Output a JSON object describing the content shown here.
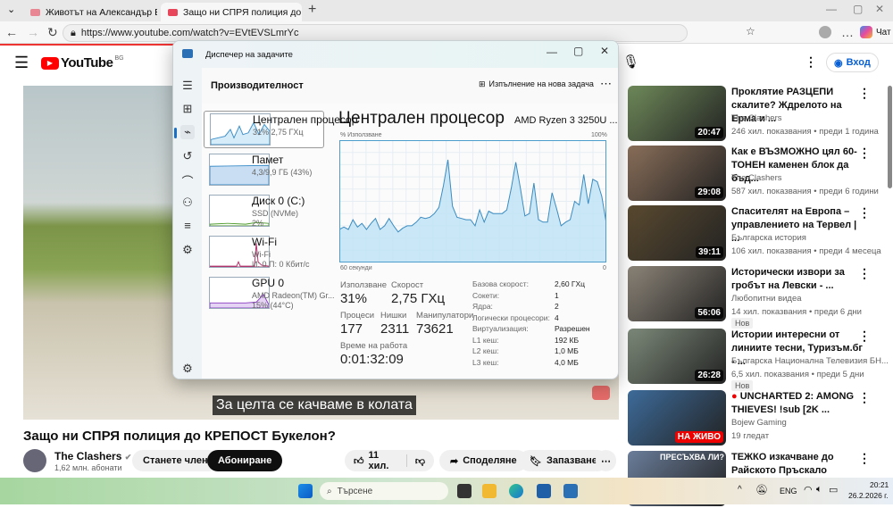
{
  "browser": {
    "tabs": [
      {
        "label": "Животът на Александър Батенбе"
      },
      {
        "label": "Защо ни СПРЯ полиция до КРЕП"
      }
    ],
    "url": "https://www.youtube.com/watch?v=EVtEVSLmrYc",
    "chat_label": "Чат"
  },
  "youtube": {
    "logo": "YouTube",
    "region": "BG",
    "signin": "Вход",
    "subtitle": "За целта се качваме в колата",
    "video_title": "Защо ни СПРЯ полиция до КРЕПОСТ Букелон?",
    "channel": "The Clashers",
    "subscribers": "1,62 млн. абонати",
    "join": "Станете член",
    "subscribe": "Абониране",
    "likes": "11 хил.",
    "share": "Споделяне",
    "save": "Запазване",
    "recs": [
      {
        "title": "Проклятие РАЗЦЕПИ скалите? Ждрелото на Ерма и ...",
        "channel": "The Clashers",
        "meta": "246 хил. показвания • преди 1 година",
        "duration": "20:47",
        "color": "#6f8a5a"
      },
      {
        "title": "Как е ВЪЗМОЖНО цял 60-ТОНЕН каменен блок да бъд...",
        "channel": "The Clashers",
        "meta": "587 хил. показвания • преди 6 години",
        "duration": "29:08",
        "color": "#8a6f5a"
      },
      {
        "title": "Спасителят на Европа – управлението на Тервел | ...",
        "channel": "Българска история",
        "meta": "106 хил. показвания • преди 4 месеца",
        "duration": "39:11",
        "color": "#5a4a30"
      },
      {
        "title": "Исторически извори за гробът на Левски - ...",
        "channel": "Любопитни видеа",
        "meta": "14 хил. показвания • преди 6 дни",
        "duration": "56:06",
        "badge": "Нов",
        "color": "#8c8478"
      },
      {
        "title": "Истории интересни от линиите тесни, Туризъм.бг - ...",
        "channel": "Българска Национална Телевизия БН...",
        "meta": "6,5 хил. показвания • преди 5 дни",
        "duration": "26:28",
        "badge": "Нов",
        "color": "#7d8a7a"
      },
      {
        "title": "UNCHARTED 2: AMONG THIEVES! !sub [2K ...",
        "channel": "Bojew Gaming",
        "meta": "19 гледат",
        "live": "НА ЖИВО",
        "color": "#3d6b9a"
      },
      {
        "title": "ТЕЖКО изкачване до Райското Пръскало",
        "thumb_text": "ПРЕСЪХВА ЛИ?",
        "color": "#6a7d9a"
      }
    ]
  },
  "taskmanager": {
    "title": "Диспечер на задачите",
    "section": "Производителност",
    "run_task": "Изпълнение на нова задача",
    "devices": [
      {
        "name": "Централен процесор",
        "sub": "31% 2,75 ГХц"
      },
      {
        "name": "Памет",
        "sub": "4,3/9,9 ГБ (43%)"
      },
      {
        "name": "Диск 0 (C:)",
        "sub": "SSD (NVMe)",
        "sub2": "2%"
      },
      {
        "name": "Wi-Fi",
        "sub": "Wi-Fi",
        "sub2": "И: 0 П: 0 Кбит/с"
      },
      {
        "name": "GPU 0",
        "sub": "AMD Radeon(TM) Gr...",
        "sub2": "15% (44°C)"
      }
    ],
    "cpu_title": "Централен процесор",
    "cpu_model": "AMD Ryzen 3 3250U ...",
    "stats": {
      "usage_label": "Използване",
      "usage": "31%",
      "speed_label": "Скорост",
      "speed": "2,75 ГХц",
      "proc_label": "Процеси",
      "proc": "177",
      "threads_label": "Нишки",
      "threads": "2311",
      "handles_label": "Манипулатори",
      "handles": "73621",
      "uptime_label": "Време на работа",
      "uptime": "0:01:32:09"
    },
    "specs": [
      [
        "Базова скорост:",
        "2,60 ГХц"
      ],
      [
        "Сокети:",
        "1"
      ],
      [
        "Ядра:",
        "2"
      ],
      [
        "Логически процесори:",
        "4"
      ],
      [
        "Виртуализация:",
        "Разрешен"
      ],
      [
        "L1 кеш:",
        "192 КБ"
      ],
      [
        "L2 кеш:",
        "1,0 МБ"
      ],
      [
        "L3 кеш:",
        "4,0 МБ"
      ]
    ]
  },
  "chart_data": {
    "type": "area",
    "title": "Централен процесор",
    "ylabel": "% Използване",
    "ymax_label": "100%",
    "xlabel_left": "60 секунди",
    "xlabel_right": "0",
    "ylim": [
      0,
      100
    ],
    "xlim": [
      60,
      0
    ],
    "grid": true,
    "values": [
      27,
      29,
      27,
      35,
      29,
      32,
      27,
      32,
      36,
      27,
      30,
      36,
      30,
      25,
      28,
      30,
      30,
      33,
      37,
      36,
      37,
      40,
      45,
      63,
      84,
      46,
      37,
      36,
      35,
      35,
      30,
      43,
      33,
      42,
      40,
      40,
      40,
      43,
      61,
      82,
      61,
      38,
      40,
      65,
      35,
      33,
      33,
      57,
      44,
      30,
      33,
      35,
      50,
      47,
      72,
      48,
      68,
      66,
      54,
      32
    ]
  },
  "taskbar": {
    "search": "Търсене",
    "lang": "ENG",
    "time": "20:21",
    "date": "26.2.2026 г."
  }
}
